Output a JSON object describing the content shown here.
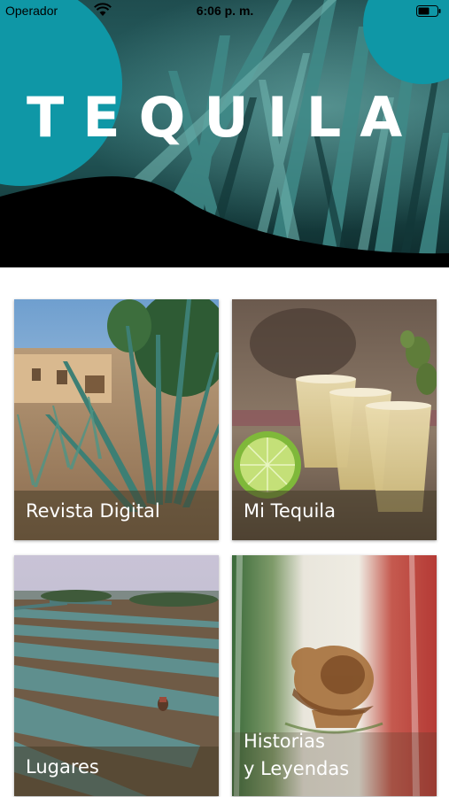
{
  "status_bar": {
    "carrier": "Operador",
    "time": "6:06 p. m.",
    "wifi_icon": "wifi-icon",
    "battery_icon": "battery-icon"
  },
  "header": {
    "title": "TEQUILA",
    "accent_color": "#0f97a6"
  },
  "tiles": [
    {
      "label": "Revista Digital",
      "image": "agave-farmhouse-photo"
    },
    {
      "label": "Mi Tequila",
      "image": "tequila-shots-lime-photo"
    },
    {
      "label": "Lugares",
      "image": "agave-fields-photo"
    },
    {
      "label_line1": "Historias",
      "label_line2": "y Leyendas",
      "image": "mexican-flag-eagle-painting"
    }
  ]
}
